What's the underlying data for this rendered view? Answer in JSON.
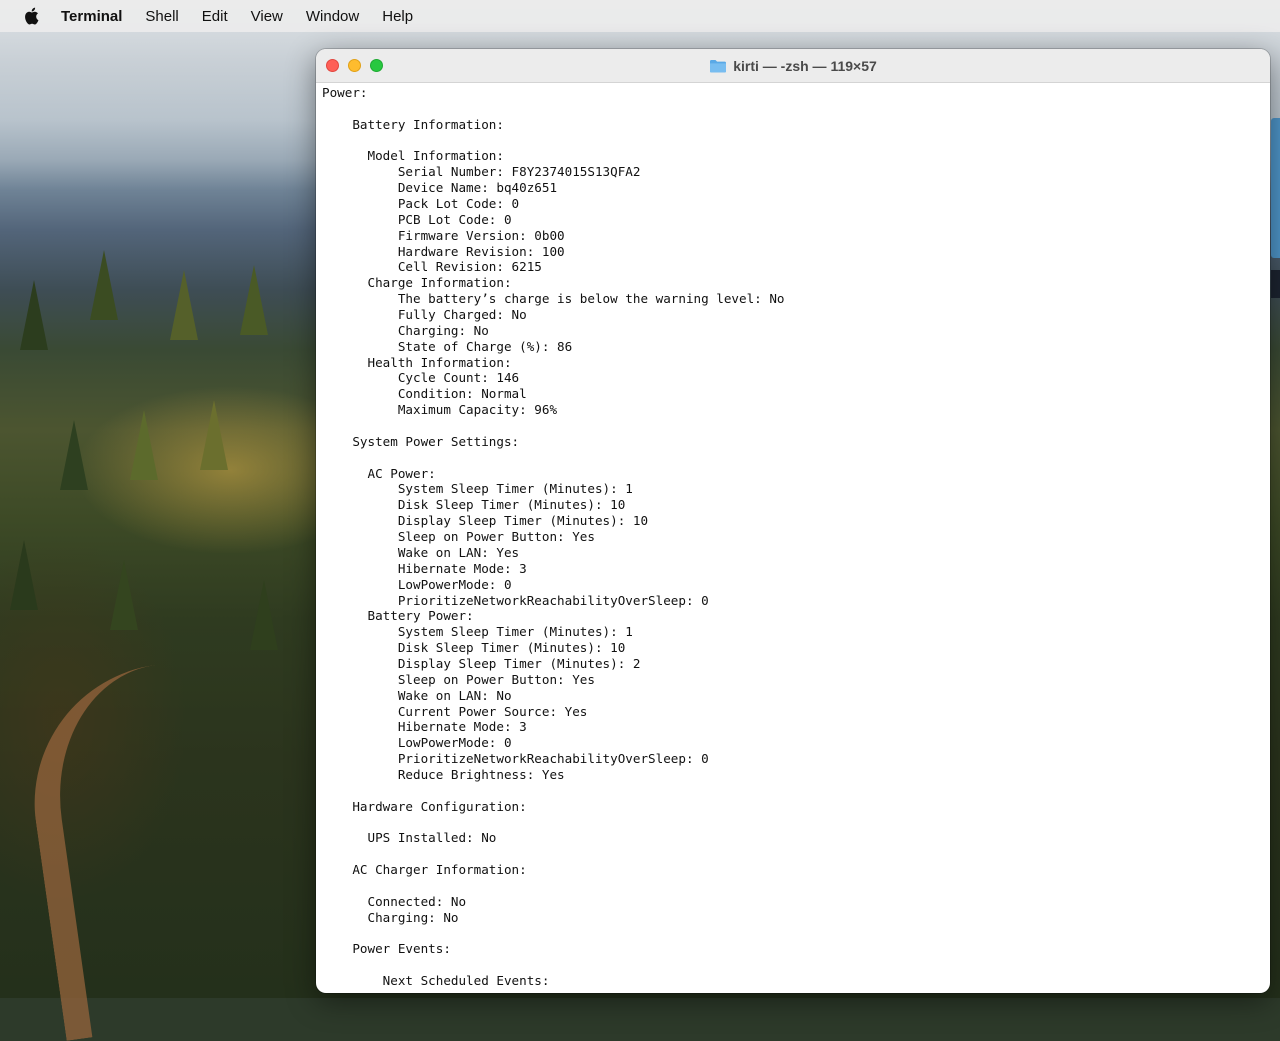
{
  "menubar": {
    "app_name": "Terminal",
    "items": [
      "Shell",
      "Edit",
      "View",
      "Window",
      "Help"
    ]
  },
  "window": {
    "title": "kirti — -zsh — 119×57"
  },
  "terminal_lines": [
    "Power:",
    "",
    "    Battery Information:",
    "",
    "      Model Information:",
    "          Serial Number: F8Y2374015S13QFA2",
    "          Device Name: bq40z651",
    "          Pack Lot Code: 0",
    "          PCB Lot Code: 0",
    "          Firmware Version: 0b00",
    "          Hardware Revision: 100",
    "          Cell Revision: 6215",
    "      Charge Information:",
    "          The battery’s charge is below the warning level: No",
    "          Fully Charged: No",
    "          Charging: No",
    "          State of Charge (%): 86",
    "      Health Information:",
    "          Cycle Count: 146",
    "          Condition: Normal",
    "          Maximum Capacity: 96%",
    "",
    "    System Power Settings:",
    "",
    "      AC Power:",
    "          System Sleep Timer (Minutes): 1",
    "          Disk Sleep Timer (Minutes): 10",
    "          Display Sleep Timer (Minutes): 10",
    "          Sleep on Power Button: Yes",
    "          Wake on LAN: Yes",
    "          Hibernate Mode: 3",
    "          LowPowerMode: 0",
    "          PrioritizeNetworkReachabilityOverSleep: 0",
    "      Battery Power:",
    "          System Sleep Timer (Minutes): 1",
    "          Disk Sleep Timer (Minutes): 10",
    "          Display Sleep Timer (Minutes): 2",
    "          Sleep on Power Button: Yes",
    "          Wake on LAN: No",
    "          Current Power Source: Yes",
    "          Hibernate Mode: 3",
    "          LowPowerMode: 0",
    "          PrioritizeNetworkReachabilityOverSleep: 0",
    "          Reduce Brightness: Yes",
    "",
    "    Hardware Configuration:",
    "",
    "      UPS Installed: No",
    "",
    "    AC Charger Information:",
    "",
    "      Connected: No",
    "      Charging: No",
    "",
    "    Power Events:",
    "",
    "        Next Scheduled Events:"
  ],
  "colors": {
    "close": "#fe5f57",
    "minimize": "#febc2e",
    "zoom": "#28c840",
    "folder": "#5aa9e6"
  }
}
